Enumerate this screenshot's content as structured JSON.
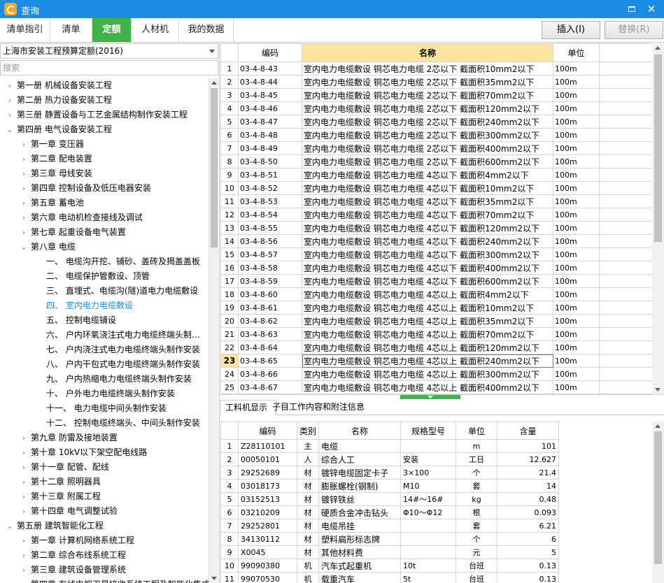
{
  "window": {
    "title": "查询"
  },
  "tabs": [
    "清单指引",
    "清单",
    "定额",
    "人材机",
    "我的数据"
  ],
  "buttons": {
    "insert": "插入(I)",
    "replace": "替换(R)"
  },
  "left": {
    "library": "上海市安装工程预算定额(2016)",
    "search_placeholder": "搜索",
    "tree": [
      {
        "label": "第一册  机械设备安装工程",
        "level": 0,
        "expanded": false
      },
      {
        "label": "第二册  热力设备安装工程",
        "level": 0,
        "expanded": false
      },
      {
        "label": "第三册  静置设备与工艺金属结构制作安装工程",
        "level": 0,
        "expanded": false
      },
      {
        "label": "第四册  电气设备安装工程",
        "level": 0,
        "expanded": true
      },
      {
        "label": "第一章  变压器",
        "level": 1,
        "expanded": false
      },
      {
        "label": "第二章  配电装置",
        "level": 1,
        "expanded": false
      },
      {
        "label": "第三章  母线安装",
        "level": 1,
        "expanded": false
      },
      {
        "label": "第四章  控制设备及低压电器安装",
        "level": 1,
        "expanded": false
      },
      {
        "label": "第五章  蓄电池",
        "level": 1,
        "expanded": false
      },
      {
        "label": "第六章  电动机检查接线及调试",
        "level": 1,
        "expanded": false
      },
      {
        "label": "第七章  起重设备电气装置",
        "level": 1,
        "expanded": false
      },
      {
        "label": "第八章  电缆",
        "level": 1,
        "expanded": true
      },
      {
        "label": "一、  电缆沟开挖、铺砂、盖砖及揭盖盖板",
        "level": 2
      },
      {
        "label": "二、  电缆保护管敷设、顶管",
        "level": 2
      },
      {
        "label": "三、  直埋式、电缆沟(隧)道电力电缆敷设",
        "level": 2
      },
      {
        "label": "四、  室内电力电缆敷设",
        "level": 2,
        "selected": true
      },
      {
        "label": "五、  控制电缆铺设",
        "level": 2
      },
      {
        "label": "六、  户内环氧浇注式电力电缆终端头制…",
        "level": 2
      },
      {
        "label": "七、  户内浇注式电力电缆终端头制作安装",
        "level": 2
      },
      {
        "label": "八、  户内干包式电力电缆终端头制作安装",
        "level": 2
      },
      {
        "label": "九、  户内热缩电力电缆终端头制作安装",
        "level": 2
      },
      {
        "label": "十、  户外电力电缆终端头制作安装",
        "level": 2
      },
      {
        "label": "十一、  电力电缆中间头制作安装",
        "level": 2
      },
      {
        "label": "十二、  控制电缆终端头、中间头制作安装",
        "level": 2
      },
      {
        "label": "第九章  防雷及接地装置",
        "level": 1,
        "expanded": false
      },
      {
        "label": "第十章  10kV以下架空配电线路",
        "level": 1,
        "expanded": false
      },
      {
        "label": "第十一章  配管、配线",
        "level": 1,
        "expanded": false
      },
      {
        "label": "第十二章  照明器具",
        "level": 1,
        "expanded": false
      },
      {
        "label": "第十三章  附属工程",
        "level": 1,
        "expanded": false
      },
      {
        "label": "第十四章  电气调整试验",
        "level": 1,
        "expanded": false
      },
      {
        "label": "第五册  建筑智能化工程",
        "level": 0,
        "expanded": true
      },
      {
        "label": "第一章  计算机网络系统工程",
        "level": 1,
        "expanded": false
      },
      {
        "label": "第二章  综合布线系统工程",
        "level": 1,
        "expanded": false
      },
      {
        "label": "第三章  建筑设备管理系统",
        "level": 1,
        "expanded": false
      },
      {
        "label": "第四章  有线电视卫星接收系统工程及智能化集成",
        "level": 1,
        "expanded": false
      }
    ]
  },
  "quota_table": {
    "headers": [
      "",
      "编码",
      "名称",
      "单位"
    ],
    "current_row": 23,
    "rows": [
      [
        "1",
        "03-4-8-43",
        "室内电力电缆敷设  铜芯电力电缆  2芯以下  截面积10mm2以下",
        "100m"
      ],
      [
        "2",
        "03-4-8-44",
        "室内电力电缆敷设  铜芯电力电缆  2芯以下  截面积35mm2以下",
        "100m"
      ],
      [
        "3",
        "03-4-8-45",
        "室内电力电缆敷设  铜芯电力电缆  2芯以下  截面积70mm2以下",
        "100m"
      ],
      [
        "4",
        "03-4-8-46",
        "室内电力电缆敷设  铜芯电力电缆  2芯以下  截面积120mm2以下",
        "100m"
      ],
      [
        "5",
        "03-4-8-47",
        "室内电力电缆敷设  铜芯电力电缆  2芯以下  截面积240mm2以下",
        "100m"
      ],
      [
        "6",
        "03-4-8-48",
        "室内电力电缆敷设  铜芯电力电缆  2芯以下  截面积300mm2以下",
        "100m"
      ],
      [
        "7",
        "03-4-8-49",
        "室内电力电缆敷设  铜芯电力电缆  2芯以下  截面积400mm2以下",
        "100m"
      ],
      [
        "8",
        "03-4-8-50",
        "室内电力电缆敷设  铜芯电力电缆  2芯以下  截面积600mm2以下",
        "100m"
      ],
      [
        "9",
        "03-4-8-51",
        "室内电力电缆敷设  铜芯电力电缆  4芯以下  截面积4mm2以下",
        "100m"
      ],
      [
        "10",
        "03-4-8-52",
        "室内电力电缆敷设  铜芯电力电缆  4芯以下  截面积10mm2以下",
        "100m"
      ],
      [
        "11",
        "03-4-8-53",
        "室内电力电缆敷设  铜芯电力电缆  4芯以下  截面积35mm2以下",
        "100m"
      ],
      [
        "12",
        "03-4-8-54",
        "室内电力电缆敷设  铜芯电力电缆  4芯以下  截面积70mm2以下",
        "100m"
      ],
      [
        "13",
        "03-4-8-55",
        "室内电力电缆敷设  铜芯电力电缆  4芯以下  截面积120mm2以下",
        "100m"
      ],
      [
        "14",
        "03-4-8-56",
        "室内电力电缆敷设  铜芯电力电缆  4芯以下  截面积240mm2以下",
        "100m"
      ],
      [
        "15",
        "03-4-8-57",
        "室内电力电缆敷设  铜芯电力电缆  4芯以下  截面积300mm2以下",
        "100m"
      ],
      [
        "16",
        "03-4-8-58",
        "室内电力电缆敷设  铜芯电力电缆  4芯以下  截面积400mm2以下",
        "100m"
      ],
      [
        "17",
        "03-4-8-59",
        "室内电力电缆敷设  铜芯电力电缆  4芯以下  截面积600mm2以下",
        "100m"
      ],
      [
        "18",
        "03-4-8-60",
        "室内电力电缆敷设  铜芯电力电缆  4芯以上  截面积4mm2以下",
        "100m"
      ],
      [
        "19",
        "03-4-8-61",
        "室内电力电缆敷设  铜芯电力电缆  4芯以上  截面积10mm2以下",
        "100m"
      ],
      [
        "20",
        "03-4-8-62",
        "室内电力电缆敷设  铜芯电力电缆  4芯以上  截面积35mm2以下",
        "100m"
      ],
      [
        "21",
        "03-4-8-63",
        "室内电力电缆敷设  铜芯电力电缆  4芯以上  截面积70mm2以下",
        "100m"
      ],
      [
        "22",
        "03-4-8-64",
        "室内电力电缆敷设  铜芯电力电缆  4芯以上  截面积120mm2以下",
        "100m"
      ],
      [
        "23",
        "03-4-8-65",
        "室内电力电缆敷设  铜芯电力电缆  4芯以上  截面积240mm2以下",
        "100m"
      ],
      [
        "24",
        "03-4-8-66",
        "室内电力电缆敷设  铜芯电力电缆  4芯以上  截面积300mm2以下",
        "100m"
      ],
      [
        "25",
        "03-4-8-67",
        "室内电力电缆敷设  铜芯电力电缆  4芯以上  截面积400mm2以下",
        "100m"
      ]
    ]
  },
  "bottom_tabs": [
    "工料机显示",
    "子目工作内容和附注信息"
  ],
  "resource_table": {
    "headers": [
      "",
      "编码",
      "类别",
      "名称",
      "规格型号",
      "单位",
      "含量"
    ],
    "rows": [
      [
        "1",
        "Z28110101",
        "主",
        "电缆",
        "",
        "m",
        "101"
      ],
      [
        "2",
        "00050101",
        "人",
        "综合人工",
        "安装",
        "工日",
        "12.627"
      ],
      [
        "3",
        "29252689",
        "材",
        "镀锌电缆固定卡子",
        "3×100",
        "个",
        "21.4"
      ],
      [
        "4",
        "03018173",
        "材",
        "膨胀螺栓(钢制)",
        "M10",
        "套",
        "14"
      ],
      [
        "5",
        "03152513",
        "材",
        "镀锌铁丝",
        "14#～16#",
        "kg",
        "0.48"
      ],
      [
        "6",
        "03210209",
        "材",
        "硬质合金冲击钻头",
        "Φ10～Φ12",
        "根",
        "0.093"
      ],
      [
        "7",
        "29252801",
        "材",
        "电缆吊挂",
        "",
        "套",
        "6.21"
      ],
      [
        "8",
        "34130112",
        "材",
        "塑料扁形标志牌",
        "",
        "个",
        "6"
      ],
      [
        "9",
        "X0045",
        "材",
        "其他材料费",
        "",
        "元",
        "5"
      ],
      [
        "10",
        "99090380",
        "机",
        "汽车式起重机",
        "10t",
        "台班",
        "0.13"
      ],
      [
        "11",
        "99070530",
        "机",
        "载重汽车",
        "5t",
        "台班",
        "0.13"
      ]
    ]
  }
}
